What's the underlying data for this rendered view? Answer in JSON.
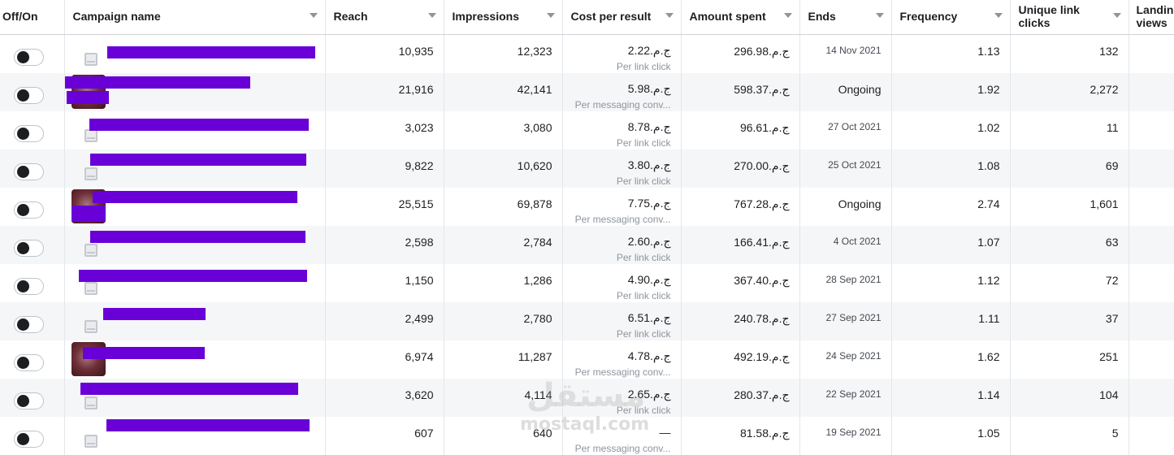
{
  "headers": {
    "off_on": "Off/On",
    "campaign_name": "Campaign name",
    "reach": "Reach",
    "impressions": "Impressions",
    "cost_per_result": "Cost per result",
    "amount_spent": "Amount spent",
    "ends": "Ends",
    "frequency": "Frequency",
    "unique_link_clicks": "Unique link clicks",
    "landing_views": "Landing views"
  },
  "rows": [
    {
      "reach": "10,935",
      "impressions": "12,323",
      "cpr_value": "ج.م.2.22",
      "cpr_label": "Per link click",
      "amount_spent": "ج.م.296.98",
      "ends": "14 Nov 2021",
      "frequency": "1.13",
      "unique_link_clicks": "132"
    },
    {
      "reach": "21,916",
      "impressions": "42,141",
      "cpr_value": "ج.م.5.98",
      "cpr_label": "Per messaging conv...",
      "amount_spent": "ج.م.598.37",
      "ends": "Ongoing",
      "frequency": "1.92",
      "unique_link_clicks": "2,272"
    },
    {
      "reach": "3,023",
      "impressions": "3,080",
      "cpr_value": "ج.م.8.78",
      "cpr_label": "Per link click",
      "amount_spent": "ج.م.96.61",
      "ends": "27 Oct 2021",
      "frequency": "1.02",
      "unique_link_clicks": "11"
    },
    {
      "reach": "9,822",
      "impressions": "10,620",
      "cpr_value": "ج.م.3.80",
      "cpr_label": "Per link click",
      "amount_spent": "ج.م.270.00",
      "ends": "25 Oct 2021",
      "frequency": "1.08",
      "unique_link_clicks": "69"
    },
    {
      "reach": "25,515",
      "impressions": "69,878",
      "cpr_value": "ج.م.7.75",
      "cpr_label": "Per messaging conv...",
      "amount_spent": "ج.م.767.28",
      "ends": "Ongoing",
      "frequency": "2.74",
      "unique_link_clicks": "1,601"
    },
    {
      "reach": "2,598",
      "impressions": "2,784",
      "cpr_value": "ج.م.2.60",
      "cpr_label": "Per link click",
      "amount_spent": "ج.م.166.41",
      "ends": "4 Oct 2021",
      "frequency": "1.07",
      "unique_link_clicks": "63"
    },
    {
      "reach": "1,150",
      "impressions": "1,286",
      "cpr_value": "ج.م.4.90",
      "cpr_label": "Per link click",
      "amount_spent": "ج.م.367.40",
      "ends": "28 Sep 2021",
      "frequency": "1.12",
      "unique_link_clicks": "72"
    },
    {
      "reach": "2,499",
      "impressions": "2,780",
      "cpr_value": "ج.م.6.51",
      "cpr_label": "Per link click",
      "amount_spent": "ج.م.240.78",
      "ends": "27 Sep 2021",
      "frequency": "1.11",
      "unique_link_clicks": "37"
    },
    {
      "reach": "6,974",
      "impressions": "11,287",
      "cpr_value": "ج.م.4.78",
      "cpr_label": "Per messaging conv...",
      "amount_spent": "ج.م.492.19",
      "ends": "24 Sep 2021",
      "frequency": "1.62",
      "unique_link_clicks": "251"
    },
    {
      "reach": "3,620",
      "impressions": "4,114",
      "cpr_value": "ج.م.2.65",
      "cpr_label": "Per link click",
      "amount_spent": "ج.م.280.37",
      "ends": "22 Sep 2021",
      "frequency": "1.14",
      "unique_link_clicks": "104"
    },
    {
      "reach": "607",
      "impressions": "640",
      "cpr_value": "—",
      "cpr_label": "Per messaging conv...",
      "amount_spent": "ج.م.81.58",
      "ends": "19 Sep 2021",
      "frequency": "1.05",
      "unique_link_clicks": "5"
    }
  ],
  "watermark": {
    "arabic": "مستقل",
    "latin": "mostaql.com"
  },
  "colors": {
    "redaction": "#6a00d8",
    "row_alt": "#f5f6f7",
    "header_border": "#d0d2d6"
  }
}
